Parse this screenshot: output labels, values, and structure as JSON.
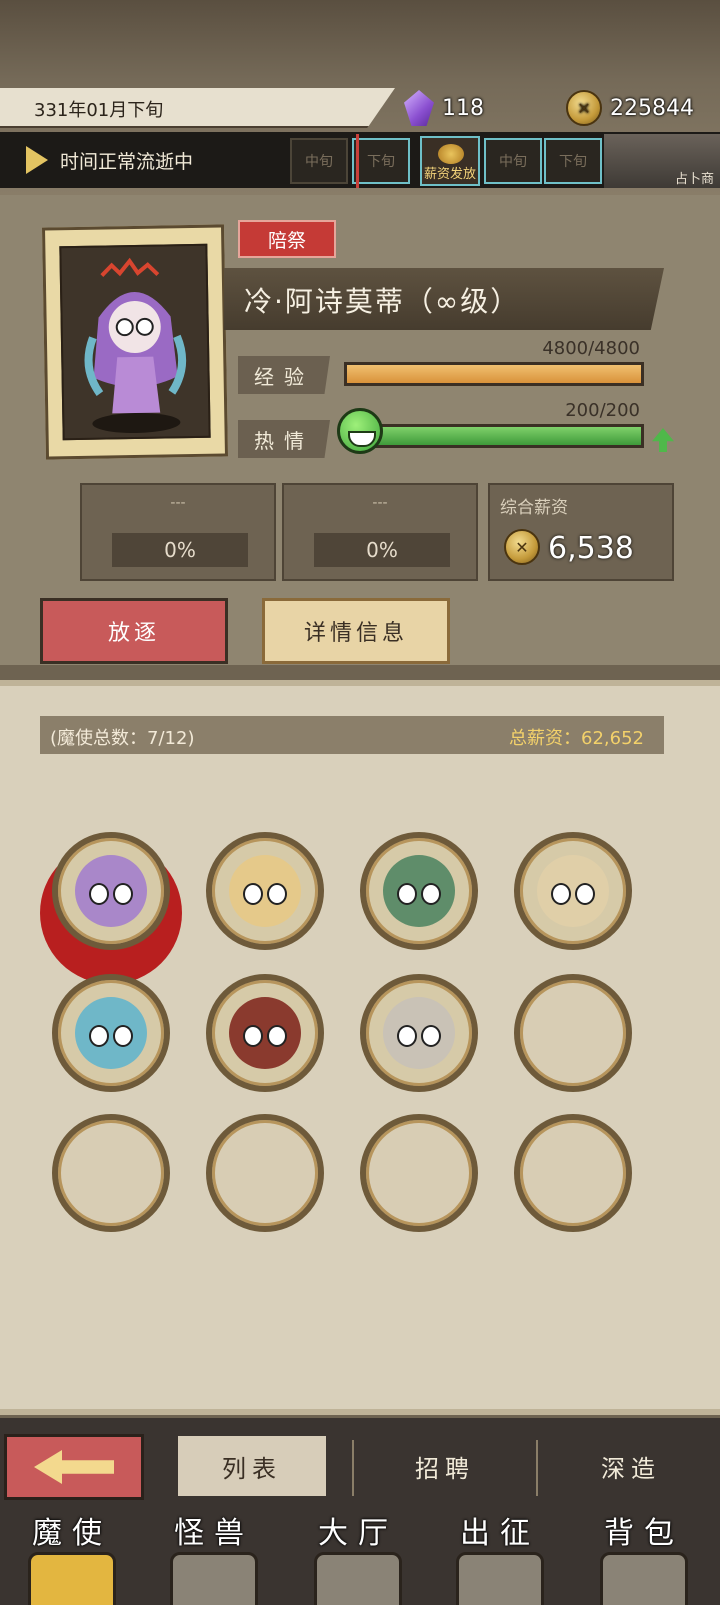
{
  "header": {
    "date": "331年01月下旬",
    "crystals": "118",
    "gold": "225844",
    "time_status": "时间正常流逝中",
    "timeline": [
      "中旬",
      "下旬",
      "中旬",
      "下旬"
    ],
    "payday_label": "薪资发放",
    "scroll_label": "占卜商"
  },
  "character": {
    "role_tag": "陪祭",
    "name": "冷·阿诗莫蒂（∞级）",
    "exp_label": "经验",
    "exp_value": "4800/4800",
    "exp_fraction": 1.0,
    "passion_label": "热情",
    "passion_value": "200/200",
    "passion_fraction": 1.0,
    "rank1_name": "---",
    "rank1_pct": "0%",
    "rank2_name": "---",
    "rank2_pct": "0%",
    "salary_label": "综合薪资",
    "salary_value": "6,538",
    "exile_button": "放逐",
    "details_button": "详情信息"
  },
  "roster": {
    "count_text": "(魔使总数：7/12)",
    "total_salary": "总薪资：62,652",
    "slots": [
      {
        "filled": true,
        "selected": true,
        "color": "#a987c9"
      },
      {
        "filled": true,
        "selected": false,
        "color": "#e5c98a"
      },
      {
        "filled": true,
        "selected": false,
        "color": "#5f8d6a"
      },
      {
        "filled": true,
        "selected": false,
        "color": "#e0cfa8"
      },
      {
        "filled": true,
        "selected": false,
        "color": "#6fb7c8"
      },
      {
        "filled": true,
        "selected": false,
        "color": "#8a3a2e"
      },
      {
        "filled": true,
        "selected": false,
        "color": "#c9c2b6"
      },
      {
        "filled": false
      },
      {
        "filled": false
      },
      {
        "filled": false
      },
      {
        "filled": false
      },
      {
        "filled": false
      }
    ]
  },
  "subtabs": [
    "列表",
    "招聘",
    "深造"
  ],
  "nav": [
    "魔使",
    "怪兽",
    "大厅",
    "出征",
    "背包"
  ]
}
